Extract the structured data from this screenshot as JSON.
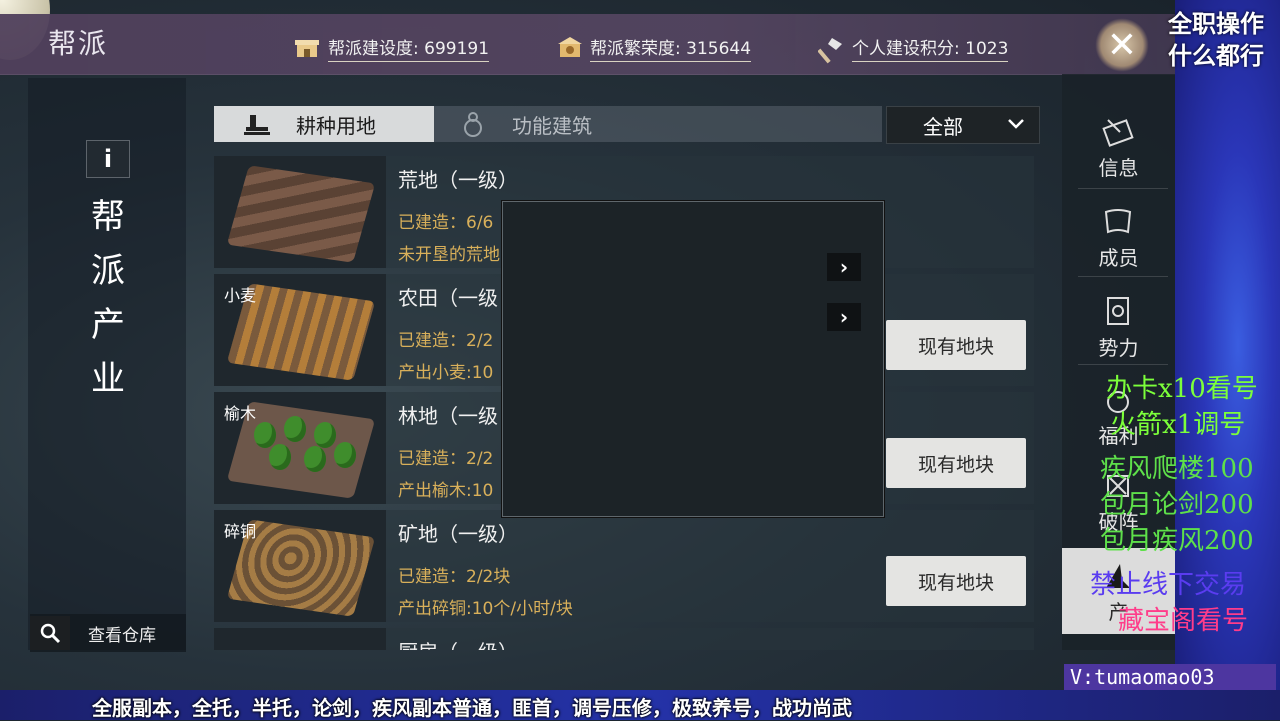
{
  "header": {
    "title": "帮派",
    "stats": [
      {
        "icon": "building-icon",
        "text": "帮派建设度: 699191"
      },
      {
        "icon": "temple-icon",
        "text": "帮派繁荣度: 315644"
      },
      {
        "icon": "axe-icon",
        "text": "个人建设积分: 1023"
      }
    ]
  },
  "left": {
    "info_label": "i",
    "vertical_title": [
      "帮",
      "派",
      "产",
      "业"
    ],
    "warehouse_label": "查看仓库"
  },
  "tabs": [
    {
      "label": "耕种用地",
      "active": true
    },
    {
      "label": "功能建筑",
      "active": false
    }
  ],
  "filter": {
    "selected": "全部"
  },
  "rows": [
    {
      "category": "",
      "title": "荒地（一级）",
      "line1": "已建造：6/6",
      "line2": "未开垦的荒地",
      "button": ""
    },
    {
      "category": "小麦",
      "title": "农田（一级",
      "line1": "已建造：2/2",
      "line2": "产出小麦:10",
      "button": "现有地块"
    },
    {
      "category": "榆木",
      "title": "林地（一级",
      "line1": "已建造：2/2",
      "line2": "产出榆木:10",
      "button": "现有地块"
    },
    {
      "category": "碎铜",
      "title": "矿地（一级）",
      "line1": "已建造：2/2块",
      "line2": "产出碎铜:10个/小时/块",
      "button": "现有地块"
    },
    {
      "category": "",
      "title": "厨房（一级）",
      "line1": "",
      "line2": "",
      "button": ""
    }
  ],
  "popup": {
    "arrow1": "›",
    "arrow2": "›"
  },
  "nav": [
    {
      "icon": "letter-icon",
      "label": "信息"
    },
    {
      "icon": "scroll-icon",
      "label": "成员"
    },
    {
      "icon": "banner-icon",
      "label": "势力"
    },
    {
      "icon": "gift-icon",
      "label": "福利"
    },
    {
      "icon": "battle-icon",
      "label": "破阵"
    },
    {
      "icon": "industry-icon",
      "label": "产"
    }
  ],
  "overlay": {
    "top_right_1": "全职操作",
    "top_right_2": "什么都行",
    "promo": [
      {
        "text": "办卡x10看号",
        "color": "#7cff3a"
      },
      {
        "text": "火箭x1调号",
        "color": "#7cff3a"
      },
      {
        "text": "疾风爬楼100",
        "color": "#5ee04a"
      },
      {
        "text": "包月论剑200",
        "color": "#5ee04a"
      },
      {
        "text": "包月疾风200",
        "color": "#5ee04a"
      },
      {
        "text": "禁止线下交易",
        "color": "#5a3cf0"
      },
      {
        "text": "藏宝阁看号",
        "color": "#ff3c8a"
      }
    ],
    "wechat": "V:tumaomao03",
    "bottom_banner": "全服副本，全托，半托，论剑，疾风副本普通，匪首，调号压修，极致养号，战功尚武"
  },
  "colors": {
    "accent_gold": "#d9b05a",
    "topbar": "#564662",
    "promo_green": "#7cff3a"
  }
}
